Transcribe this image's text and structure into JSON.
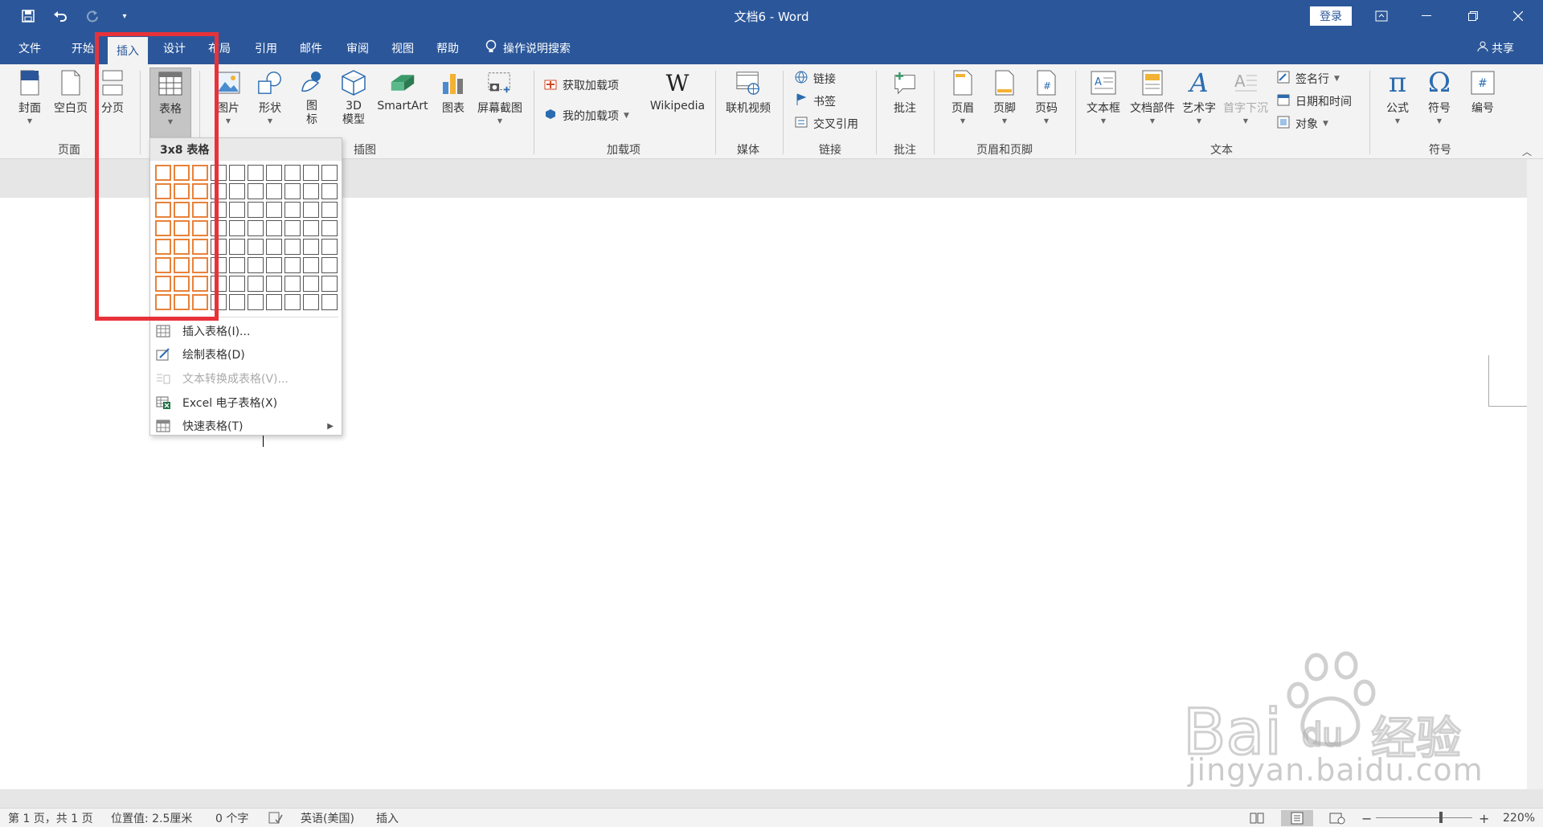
{
  "titlebar": {
    "doc_title": "文档6  -  Word",
    "login": "登录"
  },
  "tabs": [
    {
      "label": "文件"
    },
    {
      "label": "开始"
    },
    {
      "label": "插入"
    },
    {
      "label": "设计"
    },
    {
      "label": "布局"
    },
    {
      "label": "引用"
    },
    {
      "label": "邮件"
    },
    {
      "label": "审阅"
    },
    {
      "label": "视图"
    },
    {
      "label": "帮助"
    }
  ],
  "tell_me": "操作说明搜索",
  "share": "共享",
  "ribbon": {
    "groups": {
      "pages": "页面",
      "tables": "表格",
      "illustrations": "插图",
      "addins": "加载项",
      "media": "媒体",
      "links": "链接",
      "comments": "批注",
      "header_footer": "页眉和页脚",
      "text": "文本",
      "symbols": "符号"
    },
    "buttons": {
      "cover": "封面",
      "blank_page": "空白页",
      "page_break": "分页",
      "table": "表格",
      "pictures": "图片",
      "shapes": "形状",
      "icons_1": "图",
      "icons_2": "标",
      "model3d_1": "3D",
      "model3d_2": "模型",
      "smartart": "SmartArt",
      "chart": "图表",
      "screenshot": "屏幕截图",
      "get_addins": "获取加载项",
      "my_addins": "我的加载项",
      "wikipedia": "Wikipedia",
      "online_video": "联机视频",
      "link": "链接",
      "bookmark": "书签",
      "cross_ref": "交叉引用",
      "comment": "批注",
      "header": "页眉",
      "footer": "页脚",
      "page_number": "页码",
      "textbox": "文本框",
      "quick_parts": "文档部件",
      "wordart": "艺术字",
      "dropcap": "首字下沉",
      "signature": "签名行",
      "datetime": "日期和时间",
      "object": "对象",
      "equation": "公式",
      "symbol": "符号",
      "numbering": "编号"
    }
  },
  "table_dropdown": {
    "header": "3x8 表格",
    "grid_cols": 10,
    "grid_rows": 8,
    "selected_cols": 3,
    "selected_rows": 8,
    "items": [
      {
        "label": "插入表格(I)...",
        "disabled": false
      },
      {
        "label": "绘制表格(D)",
        "disabled": false
      },
      {
        "label": "文本转换成表格(V)...",
        "disabled": true
      },
      {
        "label": "Excel 电子表格(X)",
        "disabled": false
      },
      {
        "label": "快速表格(T)",
        "disabled": false
      }
    ]
  },
  "statusbar": {
    "page": "第 1 页，共 1 页",
    "position": "位置值: 2.5厘米",
    "words": "0 个字",
    "language": "英语(美国)",
    "mode": "插入",
    "zoom": "220%"
  },
  "watermark": {
    "text": "jingyan.baidu.com"
  },
  "colors": {
    "accent": "#2b579a",
    "highlight": "#e8323a",
    "grid_selected": "#e8823a"
  }
}
